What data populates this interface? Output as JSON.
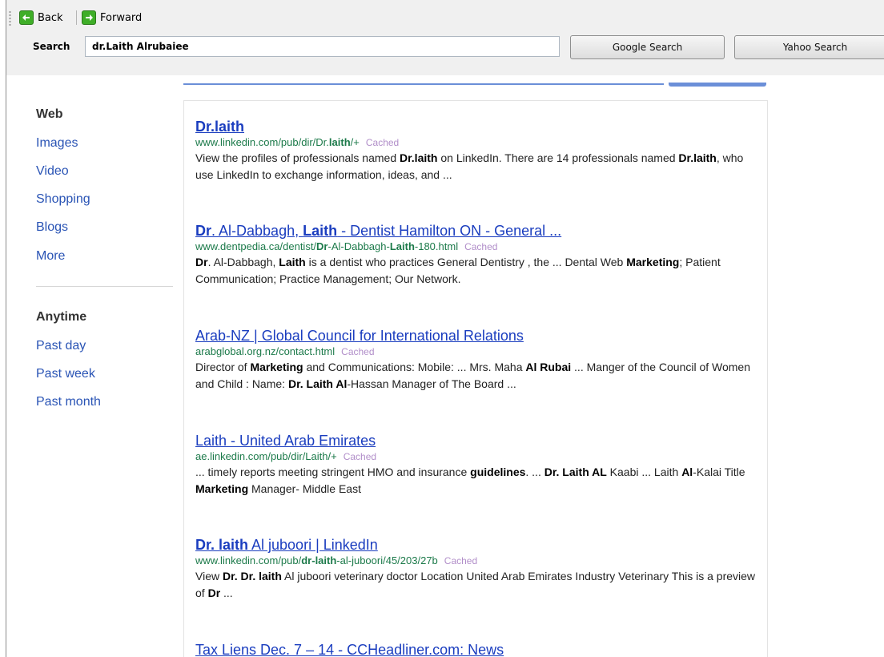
{
  "toolbar": {
    "back_label": "Back",
    "forward_label": "Forward",
    "search_label": "Search",
    "search_value": "dr.Laith Alrubaiee",
    "google_button": "Google Search",
    "yahoo_button": "Yahoo Search"
  },
  "sidebar": {
    "items": [
      {
        "label": "Web",
        "active": true
      },
      {
        "label": "Images",
        "active": false
      },
      {
        "label": "Video",
        "active": false
      },
      {
        "label": "Shopping",
        "active": false
      },
      {
        "label": "Blogs",
        "active": false
      },
      {
        "label": "More",
        "active": false
      }
    ],
    "time_items": [
      {
        "label": "Anytime",
        "active": true
      },
      {
        "label": "Past day",
        "active": false
      },
      {
        "label": "Past week",
        "active": false
      },
      {
        "label": "Past month",
        "active": false
      }
    ]
  },
  "results": [
    {
      "title": [
        {
          "t": "Dr.laith",
          "b": true
        }
      ],
      "url": [
        {
          "t": "www.linkedin.com/pub/dir/Dr."
        },
        {
          "t": "laith",
          "b": true
        },
        {
          "t": "/+"
        }
      ],
      "cached": "Cached",
      "snippet": [
        {
          "t": "View the profiles of professionals named "
        },
        {
          "t": "Dr.laith",
          "b": true
        },
        {
          "t": " on LinkedIn. There are 14 professionals named "
        },
        {
          "t": "Dr.laith",
          "b": true
        },
        {
          "t": ", who use LinkedIn to exchange information, ideas, and ..."
        }
      ]
    },
    {
      "title": [
        {
          "t": "Dr",
          "b": true
        },
        {
          "t": ". Al-Dabbagh, "
        },
        {
          "t": "Laith",
          "b": true
        },
        {
          "t": " - Dentist Hamilton ON - General ..."
        }
      ],
      "url": [
        {
          "t": "www.dentpedia.ca/dentist/"
        },
        {
          "t": "Dr",
          "b": true
        },
        {
          "t": "-Al-Dabbagh-"
        },
        {
          "t": "Laith",
          "b": true
        },
        {
          "t": "-180.html"
        }
      ],
      "cached": "Cached",
      "snippet": [
        {
          "t": "Dr",
          "b": true
        },
        {
          "t": ". Al-Dabbagh, "
        },
        {
          "t": "Laith",
          "b": true
        },
        {
          "t": " is a dentist who practices General Dentistry , the ... Dental Web "
        },
        {
          "t": "Marketing",
          "b": true
        },
        {
          "t": "; Patient Communication; Practice Management; Our Network."
        }
      ]
    },
    {
      "title": [
        {
          "t": "Arab-NZ | Global Council for International Relations"
        }
      ],
      "url": [
        {
          "t": "arabglobal.org.nz/contact.html"
        }
      ],
      "cached": "Cached",
      "snippet": [
        {
          "t": "Director of "
        },
        {
          "t": "Marketing",
          "b": true
        },
        {
          "t": " and Communications: Mobile: ... Mrs. Maha "
        },
        {
          "t": "Al Rubai",
          "b": true
        },
        {
          "t": " ... Manger of the Council of Women and Child : Name: "
        },
        {
          "t": "Dr. Laith Al",
          "b": true
        },
        {
          "t": "-Hassan Manager of The Board ..."
        }
      ]
    },
    {
      "title": [
        {
          "t": "Laith - United Arab Emirates"
        }
      ],
      "url": [
        {
          "t": "ae.linkedin.com/pub/dir/Laith/+"
        }
      ],
      "cached": "Cached",
      "snippet": [
        {
          "t": "... timely reports meeting stringent HMO and insurance "
        },
        {
          "t": "guidelines",
          "b": true
        },
        {
          "t": ". ... "
        },
        {
          "t": "Dr. Laith AL",
          "b": true
        },
        {
          "t": " Kaabi ... Laith "
        },
        {
          "t": "Al",
          "b": true
        },
        {
          "t": "-Kalai Title "
        },
        {
          "t": "Marketing",
          "b": true
        },
        {
          "t": " Manager- Middle East"
        }
      ]
    },
    {
      "title": [
        {
          "t": "Dr. laith",
          "b": true
        },
        {
          "t": " Al juboori | LinkedIn"
        }
      ],
      "url": [
        {
          "t": "www.linkedin.com/pub/"
        },
        {
          "t": "dr-laith",
          "b": true
        },
        {
          "t": "-al-juboori/45/203/27b"
        }
      ],
      "cached": "Cached",
      "snippet": [
        {
          "t": "View "
        },
        {
          "t": "Dr. Dr. laith",
          "b": true
        },
        {
          "t": " Al juboori veterinary doctor Location United Arab Emirates Industry Veterinary This is a preview of "
        },
        {
          "t": "Dr",
          "b": true
        },
        {
          "t": " ..."
        }
      ]
    },
    {
      "title": [
        {
          "t": "Tax Liens Dec. 7 – 14 - CCHeadliner.com: News"
        }
      ],
      "url": [],
      "cached": "",
      "snippet": []
    }
  ]
}
